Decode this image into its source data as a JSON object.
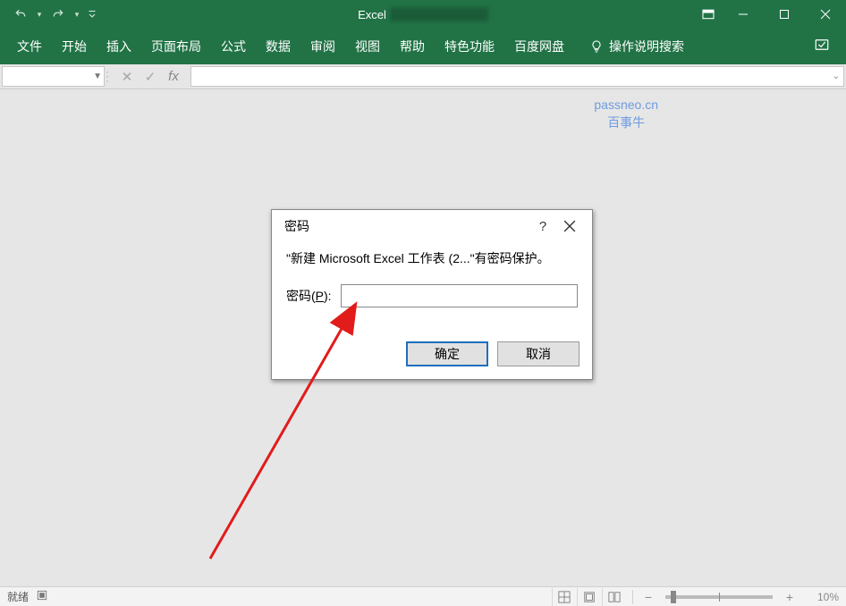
{
  "titlebar": {
    "app_name": "Excel"
  },
  "tabs": {
    "file": "文件",
    "home": "开始",
    "insert": "插入",
    "page_layout": "页面布局",
    "formulas": "公式",
    "data": "数据",
    "review": "审阅",
    "view": "视图",
    "help": "帮助",
    "special": "特色功能",
    "baidu": "百度网盘",
    "tell_me": "操作说明搜索"
  },
  "formula_bar": {
    "name_box_value": "",
    "cancel": "✕",
    "enter": "✓",
    "fx": "fx",
    "input_value": ""
  },
  "watermark": {
    "line1": "passneo.cn",
    "line2": "百事牛"
  },
  "dialog": {
    "title": "密码",
    "message": "\"新建 Microsoft Excel 工作表 (2...\"有密码保护。",
    "field_label_pre": "密码(",
    "field_label_hot": "P",
    "field_label_post": "):",
    "field_value": "",
    "ok": "确定",
    "cancel": "取消"
  },
  "statusbar": {
    "ready": "就绪",
    "zoom_percent": "10%"
  }
}
